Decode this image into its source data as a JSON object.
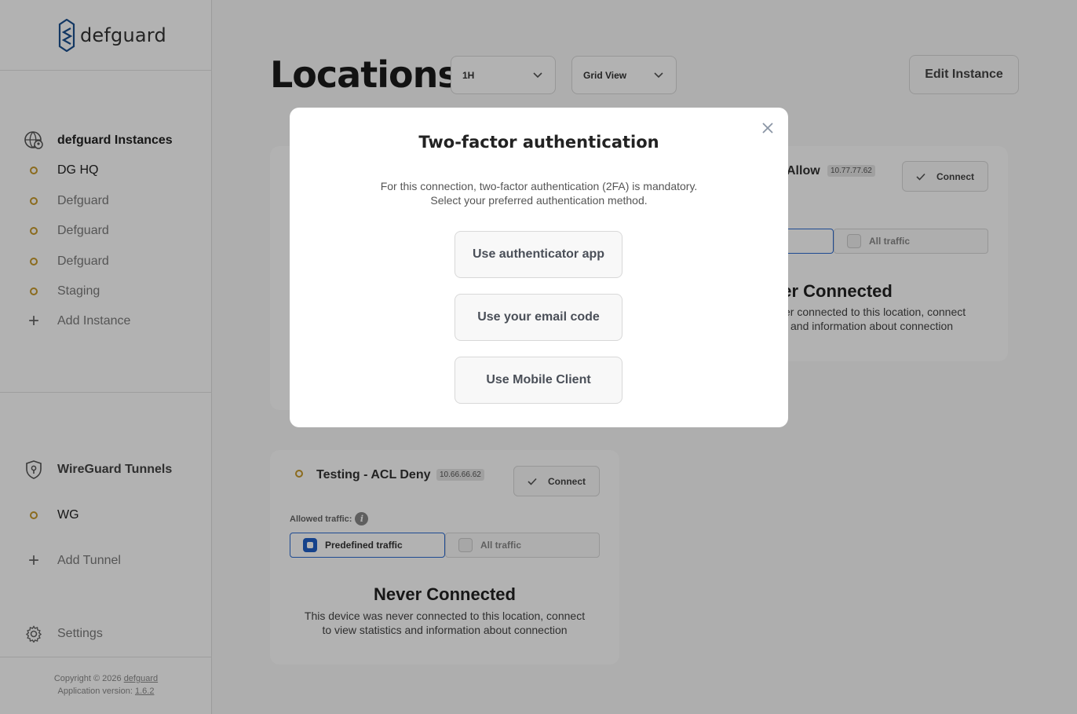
{
  "app": {
    "logo_text": "defguard"
  },
  "sidebar": {
    "instances_header": "defguard Instances",
    "instances": [
      {
        "label": "DG HQ"
      },
      {
        "label": "Defguard"
      },
      {
        "label": "Defguard"
      },
      {
        "label": "Defguard"
      },
      {
        "label": "Staging"
      }
    ],
    "add_instance": "Add Instance",
    "tunnels_header": "WireGuard Tunnels",
    "tunnels": [
      {
        "label": "WG"
      }
    ],
    "add_tunnel": "Add Tunnel",
    "settings": "Settings",
    "footer": {
      "copyright_prefix": "Copyright © 2026",
      "copyright_link": "defguard",
      "version_prefix": "Application version:",
      "version": "1.6.2"
    }
  },
  "main": {
    "title": "Locations",
    "period_select": "1H",
    "view_select": "Grid View",
    "edit_button": "Edit Instance",
    "cards": [
      {
        "name_partial": "Allow",
        "ip": "10.77.77.62",
        "connect_label": "Connect",
        "toggle_all": "All traffic",
        "never_title_partial": "ver Connected",
        "never_desc_line1_partial": "er connected to this location, connect",
        "never_desc_line2_partial": "and information about connection"
      },
      {
        "name": "Testing - ACL Deny",
        "ip": "10.66.66.62",
        "connect_label": "Connect",
        "allowed_traffic_label": "Allowed traffic:",
        "toggle_predefined": "Predefined traffic",
        "toggle_all": "All traffic",
        "never_title": "Never Connected",
        "never_desc_line1": "This device was never connected to this location, connect",
        "never_desc_line2": "to view statistics and information about connection"
      }
    ]
  },
  "modal": {
    "title": "Two-factor authentication",
    "desc_line1": "For this connection, two-factor authentication (2FA) is mandatory.",
    "desc_line2": "Select your preferred authentication method.",
    "buttons": [
      {
        "label": "Use authenticator app"
      },
      {
        "label": "Use your email code"
      },
      {
        "label": "Use Mobile Client"
      }
    ]
  },
  "colors": {
    "accent_blue": "#1f5fc7",
    "status_dot": "#c79a2b",
    "overlay": "rgba(0,0,0,0.30)"
  }
}
